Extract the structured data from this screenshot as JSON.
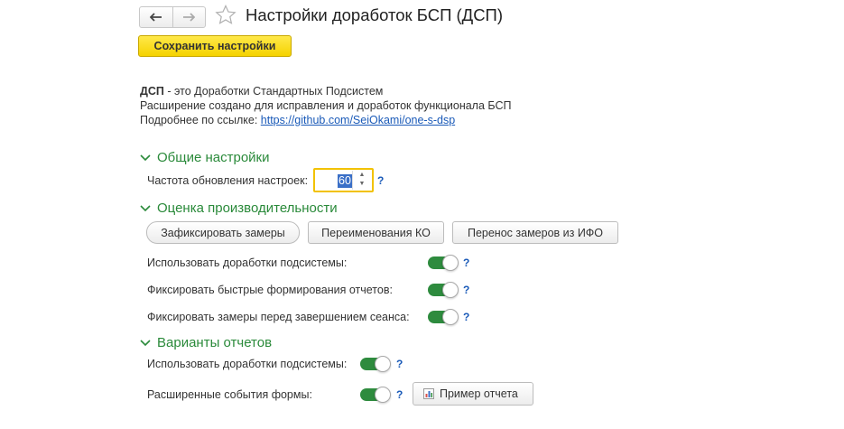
{
  "header": {
    "title": "Настройки доработок БСП (ДСП)",
    "back_icon": "arrow-left-icon",
    "forward_icon": "arrow-right-icon",
    "favorite_icon": "star-icon"
  },
  "toolbar": {
    "save_label": "Сохранить настройки"
  },
  "info": {
    "line1_bold": "ДСП",
    "line1_rest": " - это Доработки Стандартных Подсистем",
    "line2": "Расширение создано для исправления и доработок функционала БСП",
    "line3_prefix": "Подробнее по ссылке: ",
    "link": "https://github.com/SeiOkami/one-s-dsp"
  },
  "general": {
    "title": "Общие настройки",
    "refresh_label": "Частота обновления настроек:",
    "refresh_value": "60",
    "help": "?"
  },
  "performance": {
    "title": "Оценка производительности",
    "buttons": [
      "Зафиксировать замеры",
      "Переименования КО",
      "Перенос замеров из ИФО"
    ],
    "toggles": [
      {
        "label": "Использовать доработки подсистемы:",
        "on": true
      },
      {
        "label": "Фиксировать быстрые формирования отчетов:",
        "on": true
      },
      {
        "label": "Фиксировать замеры перед завершением сеанса:",
        "on": true
      }
    ],
    "help": "?"
  },
  "reports": {
    "title": "Варианты отчетов",
    "toggles": [
      {
        "label": "Использовать доработки подсистемы:",
        "on": true
      },
      {
        "label": "Расширенные события формы:",
        "on": true
      }
    ],
    "sample_button": "Пример отчета",
    "help": "?"
  },
  "colors": {
    "accent_green": "#2a8a3a",
    "save_yellow": "#f5d300",
    "link_blue": "#1a5ab8"
  }
}
